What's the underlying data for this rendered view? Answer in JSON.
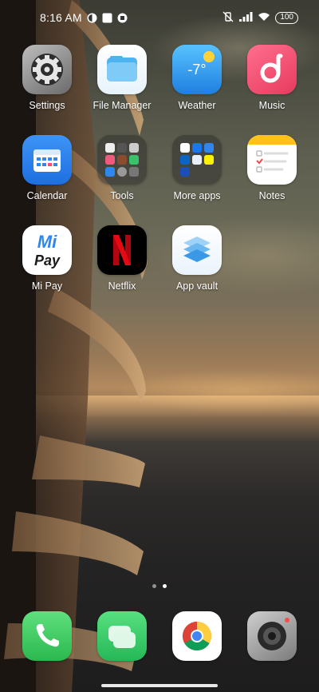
{
  "status_bar": {
    "time": "8:16 AM",
    "battery": "100",
    "left_icons": [
      "notification-icon-1",
      "notification-icon-2",
      "notification-icon-3"
    ],
    "right_icons": [
      "vibrate-mute-icon",
      "signal-icon",
      "wifi-icon",
      "battery-icon"
    ]
  },
  "apps": [
    {
      "label": "Settings",
      "icon": "settings-icon"
    },
    {
      "label": "File Manager",
      "icon": "file-manager-icon"
    },
    {
      "label": "Weather",
      "icon": "weather-icon",
      "temp": "-7°"
    },
    {
      "label": "Music",
      "icon": "music-icon"
    },
    {
      "label": "Calendar",
      "icon": "calendar-icon"
    },
    {
      "label": "Tools",
      "icon": "tools-folder-icon"
    },
    {
      "label": "More apps",
      "icon": "more-apps-folder-icon"
    },
    {
      "label": "Notes",
      "icon": "notes-icon"
    },
    {
      "label": "Mi Pay",
      "icon": "mi-pay-icon",
      "logo_top": "Mi",
      "logo_bottom": "Pay"
    },
    {
      "label": "Netflix",
      "icon": "netflix-icon",
      "logo": "N"
    },
    {
      "label": "App vault",
      "icon": "app-vault-icon"
    }
  ],
  "page_indicator": {
    "pages": 2,
    "current": 2
  },
  "dock": [
    {
      "name": "phone",
      "icon": "phone-icon"
    },
    {
      "name": "messages",
      "icon": "messages-icon"
    },
    {
      "name": "chrome",
      "icon": "chrome-icon"
    },
    {
      "name": "camera",
      "icon": "camera-icon"
    }
  ],
  "colors": {
    "settings": "#9a9a9a",
    "file_manager": "#6ec6f5",
    "weather": "#3aa0f0",
    "music": "#f2506e",
    "calendar": "#2f86ee",
    "notes": "#ffffff",
    "netflix_red": "#e50914",
    "phone": "#35c759",
    "messages": "#3ad26a"
  }
}
